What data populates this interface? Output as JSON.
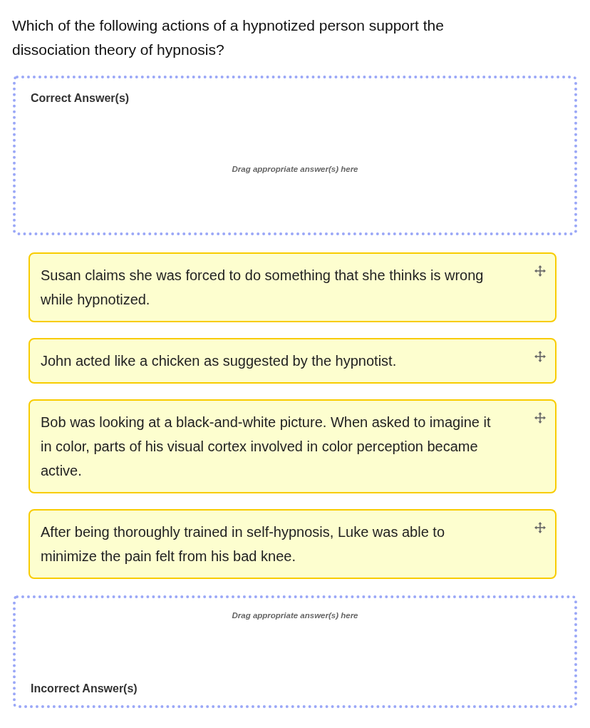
{
  "question": "Which of the following actions of a hypnotized person support the dissociation theory of hypnosis?",
  "correct_zone": {
    "title": "Correct Answer(s)",
    "placeholder": "Drag appropriate answer(s) here"
  },
  "answer_cards": [
    {
      "text": "Susan claims she was forced to do something that she thinks is wrong while hypnotized."
    },
    {
      "text": "John acted like a chicken as suggested by the hypnotist."
    },
    {
      "text": "Bob was looking at a black-and-white picture. When asked to imagine it in color, parts of his visual cortex involved in color perception became active."
    },
    {
      "text": "After being thoroughly trained in self-hypnosis, Luke was able to minimize the pain felt from his bad knee."
    }
  ],
  "incorrect_zone": {
    "title": "Incorrect Answer(s)",
    "placeholder": "Drag appropriate answer(s) here"
  }
}
